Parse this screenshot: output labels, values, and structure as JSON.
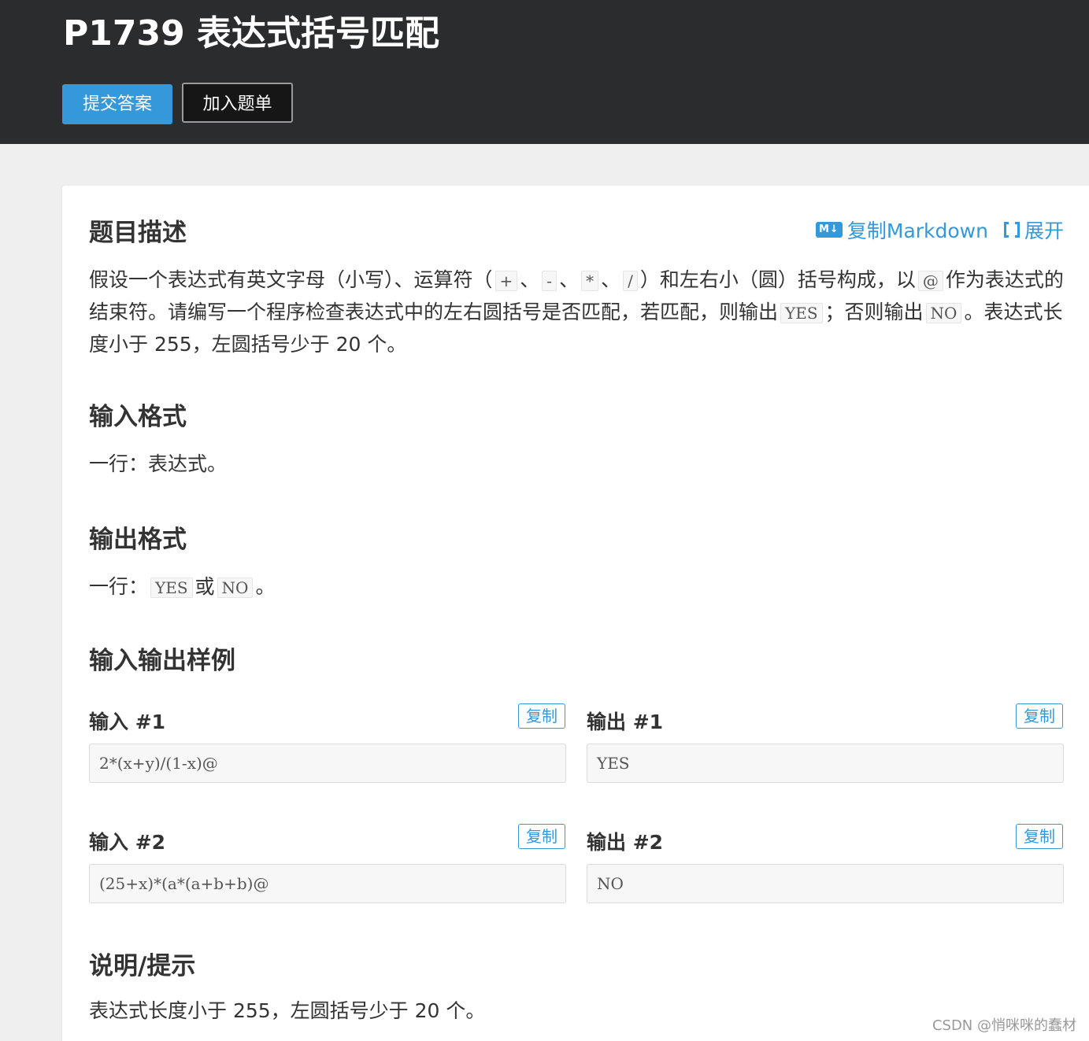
{
  "header": {
    "title": "P1739 表达式括号匹配",
    "submit_label": "提交答案",
    "add_label": "加入题单"
  },
  "toolbar": {
    "md_badge": "M↓",
    "copy_markdown": "复制Markdown",
    "expand": "展开"
  },
  "description": {
    "heading": "题目描述",
    "t1": "假设一个表达式有英文字母（小写）、运算符（",
    "c1": "+",
    "t2": "、",
    "c2": "-",
    "t3": "、",
    "c3": "*",
    "t4": "、",
    "c4": "/",
    "t5": "）和左右小（圆）括号构成，以",
    "c5": "@",
    "t6": "作为表达式的结束符。请编写一个程序检查表达式中的左右圆括号是否匹配，若匹配，则输出",
    "c6": "YES",
    "t7": "；否则输出",
    "c7": "NO",
    "t8": "。表达式长度小于 255，左圆括号少于 20 个。"
  },
  "input_format": {
    "heading": "输入格式",
    "text": "一行：表达式。"
  },
  "output_format": {
    "heading": "输出格式",
    "t1": "一行：",
    "c1": "YES",
    "t2": "或",
    "c2": "NO",
    "t3": "。"
  },
  "samples": {
    "heading": "输入输出样例",
    "copy_label": "复制",
    "items": [
      {
        "input_title": "输入 #1",
        "input": "2*(x+y)/(1-x)@",
        "output_title": "输出 #1",
        "output": "YES"
      },
      {
        "input_title": "输入 #2",
        "input": "(25+x)*(a*(a+b+b)@",
        "output_title": "输出 #2",
        "output": "NO"
      }
    ]
  },
  "hint": {
    "heading": "说明/提示",
    "text": "表达式长度小于 255，左圆括号少于 20 个。"
  },
  "watermark": "CSDN @悄咪咪的蠢材",
  "colors": {
    "header_bg": "#2b2c2e",
    "accent": "#3498db",
    "page_bg": "#efefef"
  }
}
